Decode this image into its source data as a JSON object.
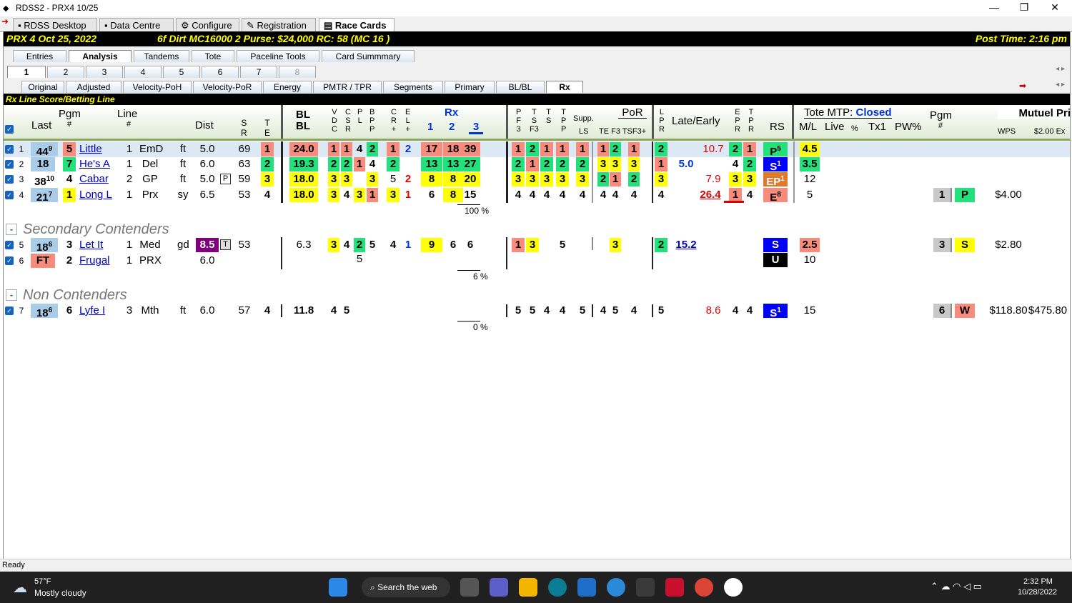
{
  "window": {
    "title": "RDSS2 - PRX4  10/25"
  },
  "top_tabs": [
    "RDSS Desktop",
    "Data Centre",
    "Configure",
    "Registration",
    "Race Cards"
  ],
  "info": {
    "track": "PRX  4  Oct 25, 2022",
    "race": "6f  Dirt  MC16000  2  Purse: $24,000  RC: 58  (MC 16 )",
    "post": "Post Time: 2:16 pm"
  },
  "main_tabs": [
    "Entries",
    "Analysis",
    "Tandems",
    "Tote",
    "Paceline Tools",
    "Card Summmary"
  ],
  "num_tabs": [
    "1",
    "2",
    "3",
    "4",
    "5",
    "6",
    "7",
    "8"
  ],
  "sub_tabs": [
    "Original",
    "Adjusted",
    "Velocity-PoH",
    "Velocity-PoR",
    "Energy",
    "PMTR / TPR",
    "Segments",
    "Primary",
    "BL/BL",
    "Rx"
  ],
  "section_title": "Rx Line Score/Betting Line",
  "headers": {
    "pgm": "Pgm",
    "hash": "#",
    "last": "Last",
    "line": "Line",
    "dist": "Dist",
    "sr": "S\nR",
    "te": "T\nE",
    "blbl": "BL\nBL",
    "vdc": "V\nD\nC",
    "csr": "C\nS\nR",
    "pl": "P\nL",
    "bp": "B\nP\nP",
    "cr": "C\nR\n+",
    "el": "E\nL\n+",
    "rx": "Rx",
    "rx1": "1",
    "rx2": "2",
    "rx3": "3",
    "pf3": "P\nF\n3",
    "tsf3": "T\nS\nF3",
    "ts": "T\nS",
    "tpp": "T\nP\nP",
    "supp": "Supp.",
    "ls": "LS",
    "por": "PoR",
    "por_sub": "TE F3  TSF3+",
    "lpr": "L\nP\nR",
    "late": "Late/Early",
    "epr": "E\nP\nR",
    "tpr": "T\nP\nR",
    "rs": "RS",
    "tote": "Tote MTP:",
    "tote_status": "Closed",
    "ml": "M/L",
    "live": "Live",
    "pct": "%",
    "tx1": "Tx1",
    "pw": "PW%",
    "pgm2": "Pgm",
    "mutuel": "Mutuel Pri",
    "wps": "WPS",
    "ex": "$2.00 Ex"
  },
  "sections": {
    "secondary": "Secondary Contenders",
    "non": "Non Contenders"
  },
  "pct_labels": [
    "100 %",
    "6 %",
    "0 %"
  ],
  "rows": [
    {
      "n": "1",
      "last": "44",
      "last_sup": "9",
      "pgm": "5",
      "name": "Little",
      "line": "1",
      "trk": "EmD",
      "cond": "ft",
      "dist": "5.0",
      "sr": "69",
      "te": "1",
      "bl": "24.0",
      "vdc": "1",
      "csr": "1",
      "pl": "4",
      "bp": "2",
      "cr": "1",
      "el": "2",
      "rx1": "17",
      "rx2": "18",
      "rx3": "39",
      "pf3": "1",
      "tsf3": "2",
      "ts": "1",
      "tpp": "1",
      "ls": "1",
      "pte": "1",
      "pf3b": "2",
      "ptsf": "1",
      "lpr": "2",
      "late": "",
      "early": "10.7",
      "epr": "2",
      "tpr": "1",
      "rs": "P",
      "rs_sup": "5",
      "ml": "4.5"
    },
    {
      "n": "2",
      "last": "18",
      "last_sup": "",
      "pgm": "7",
      "name": "He's A",
      "line": "1",
      "trk": "Del",
      "cond": "ft",
      "dist": "6.0",
      "sr": "63",
      "te": "2",
      "bl": "19.3",
      "vdc": "2",
      "csr": "2",
      "pl": "1",
      "bp": "4",
      "cr": "2",
      "el": "",
      "rx1": "13",
      "rx2": "13",
      "rx3": "27",
      "pf3": "2",
      "tsf3": "1",
      "ts": "2",
      "tpp": "2",
      "ls": "2",
      "pte": "3",
      "pf3b": "3",
      "ptsf": "3",
      "lpr": "1",
      "late": "5.0",
      "early": "",
      "epr": "4",
      "tpr": "2",
      "rs": "S",
      "rs_sup": "1",
      "ml": "3.5"
    },
    {
      "n": "3",
      "last": "38",
      "last_sup": "10",
      "pgm": "4",
      "name": "Cabar",
      "line": "2",
      "trk": "GP",
      "cond": "ft",
      "dist": "5.0",
      "dist_tag": "P",
      "sr": "59",
      "te": "3",
      "bl": "18.0",
      "vdc": "3",
      "csr": "3",
      "pl": "",
      "bp": "3",
      "cr": "5",
      "el": "2",
      "rx1": "8",
      "rx2": "8",
      "rx3": "20",
      "pf3": "3",
      "tsf3": "3",
      "ts": "3",
      "tpp": "3",
      "ls": "3",
      "pte": "2",
      "pf3b": "1",
      "ptsf": "2",
      "lpr": "3",
      "late": "",
      "early": "7.9",
      "epr": "3",
      "tpr": "3",
      "rs": "EP",
      "rs_sup": "1",
      "ml": "12"
    },
    {
      "n": "4",
      "last": "21",
      "last_sup": "7",
      "pgm": "1",
      "name": "Long L",
      "line": "1",
      "trk": "Prx",
      "cond": "sy",
      "dist": "6.5",
      "sr": "53",
      "te": "4",
      "bl": "18.0",
      "vdc": "3",
      "csr": "4",
      "pl": "3",
      "bp": "1",
      "cr": "3",
      "el": "1",
      "rx1": "6",
      "rx2": "8",
      "rx3": "15",
      "pf3": "4",
      "tsf3": "4",
      "ts": "4",
      "tpp": "4",
      "ls": "4",
      "pte": "4",
      "pf3b": "4",
      "ptsf": "4",
      "lpr": "4",
      "late": "",
      "early": "26.4",
      "epr": "1",
      "tpr": "4",
      "rs": "E",
      "rs_sup": "8",
      "ml": "5",
      "pos": "1",
      "pos_l": "P",
      "pay": "$4.00"
    },
    {
      "n": "5",
      "last": "18",
      "last_sup": "6",
      "pgm": "3",
      "name": "Let It",
      "line": "1",
      "trk": "Med",
      "cond": "gd",
      "dist": "8.5",
      "dist_tag": "T",
      "sr": "53",
      "te": "",
      "bl": "6.3",
      "vdc": "3",
      "csr": "4",
      "pl": "2",
      "bp": "5",
      "bp2": "5",
      "cr": "4",
      "el": "1",
      "rx1": "9",
      "rx2": "6",
      "rx3": "6",
      "pf3": "1",
      "tsf3": "3",
      "ts": "",
      "tpp": "5",
      "ls": "",
      "pte": "",
      "pf3b": "3",
      "ptsf": "",
      "lpr": "2",
      "late": "15.2",
      "early": "",
      "epr": "",
      "tpr": "",
      "rs": "S",
      "rs2": "U",
      "ml": "2.5",
      "ml2": "10",
      "pos": "3",
      "pos_l": "S",
      "pay": "$2.80"
    },
    {
      "n": "6",
      "last": "FT",
      "pgm": "2",
      "name": "Frugal",
      "line": "1",
      "trk": "PRX",
      "dist": "6.0"
    },
    {
      "n": "7",
      "last": "18",
      "last_sup": "6",
      "pgm": "6",
      "name": "Lyfe I",
      "line": "3",
      "trk": "Mth",
      "cond": "ft",
      "dist": "6.0",
      "sr": "57",
      "te": "4",
      "bl": "11.8",
      "vdc": "4",
      "csr": "5",
      "rx1": "",
      "rx2": "",
      "rx3": "",
      "pf3": "5",
      "tsf3": "5",
      "ts": "4",
      "tpp": "4",
      "ls": "5",
      "pte": "4",
      "pf3b": "5",
      "ptsf": "4",
      "lpr": "5",
      "early": "8.6",
      "epr": "4",
      "tpr": "4",
      "rs": "S",
      "rs_sup": "1",
      "ml": "15",
      "pos": "6",
      "pos_l": "W",
      "pay": "$118.80",
      "pay2": "$475.80"
    }
  ],
  "status": "Ready",
  "taskbar": {
    "temp": "57°F",
    "weather": "Mostly cloudy",
    "search": "Search the web",
    "time": "2:32 PM",
    "date": "10/28/2022"
  }
}
